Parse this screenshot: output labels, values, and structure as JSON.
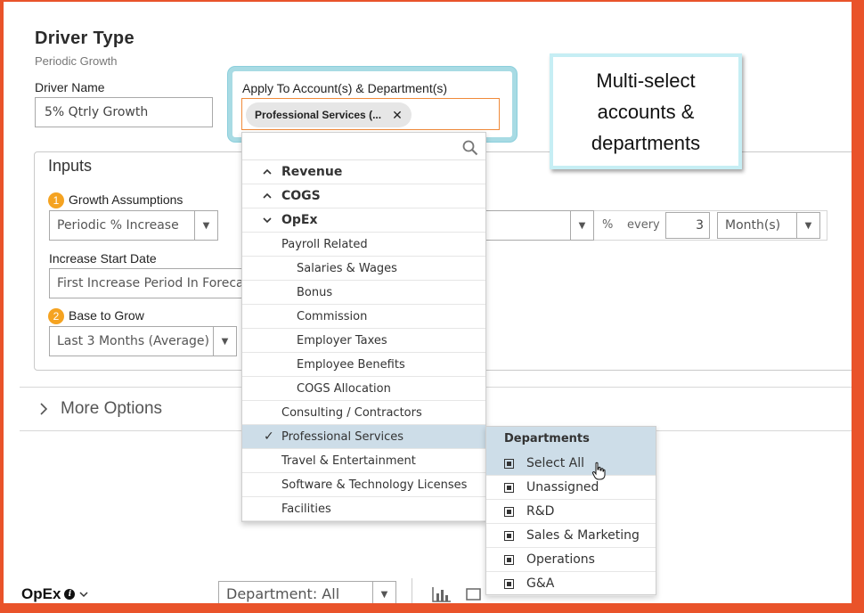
{
  "header": {
    "title": "Driver Type",
    "subtitle": "Periodic Growth"
  },
  "driver_name": {
    "label": "Driver Name",
    "value": "5% Qtrly Growth"
  },
  "apply_to": {
    "label": "Apply To Account(s) & Department(s)",
    "tag": "Professional Services (...",
    "tag_remove": "✕"
  },
  "callout": {
    "text": "Multi-select accounts & departments"
  },
  "inputs": {
    "title": "Inputs",
    "growth_assumptions": {
      "badge": "1",
      "label": "Growth Assumptions",
      "value": "Periodic % Increase"
    },
    "increase_start": {
      "label": "Increase Start Date",
      "value": "First Increase Period In Forecast"
    },
    "base_to_grow": {
      "badge": "2",
      "label": "Base to Grow",
      "value": "Last 3 Months (Average)"
    },
    "percent_symbol": "%",
    "every_label": "every",
    "every_value": "3",
    "period_unit": "Month(s)"
  },
  "more_options": {
    "label": "More Options"
  },
  "account_dropdown": {
    "items": [
      {
        "label": "Revenue",
        "type": "group",
        "caret": "^"
      },
      {
        "label": "COGS",
        "type": "group",
        "caret": "^"
      },
      {
        "label": "OpEx",
        "type": "group",
        "caret": "v"
      },
      {
        "label": "Payroll Related",
        "type": "sub"
      },
      {
        "label": "Salaries & Wages",
        "type": "leaf"
      },
      {
        "label": "Bonus",
        "type": "leaf"
      },
      {
        "label": "Commission",
        "type": "leaf"
      },
      {
        "label": "Employer Taxes",
        "type": "leaf"
      },
      {
        "label": "Employee Benefits",
        "type": "leaf"
      },
      {
        "label": "COGS Allocation",
        "type": "leaf"
      },
      {
        "label": "Consulting / Contractors",
        "type": "sub"
      },
      {
        "label": "Professional Services",
        "type": "sub",
        "selected": true,
        "check": "✓"
      },
      {
        "label": "Travel & Entertainment",
        "type": "sub"
      },
      {
        "label": "Software & Technology Licenses",
        "type": "sub"
      },
      {
        "label": "Facilities",
        "type": "sub"
      }
    ]
  },
  "departments_menu": {
    "title": "Departments",
    "items": [
      "Select All",
      "Unassigned",
      "R&D",
      "Sales & Marketing",
      "Operations",
      "G&A"
    ]
  },
  "bottom_bar": {
    "title": "OpEx",
    "info": "i",
    "department_filter": "Department: All"
  },
  "colors": {
    "accent_orange": "#f5a321",
    "highlight": "#cddde8",
    "callout_border": "#a8dbe4",
    "frame": "#e9532a"
  }
}
